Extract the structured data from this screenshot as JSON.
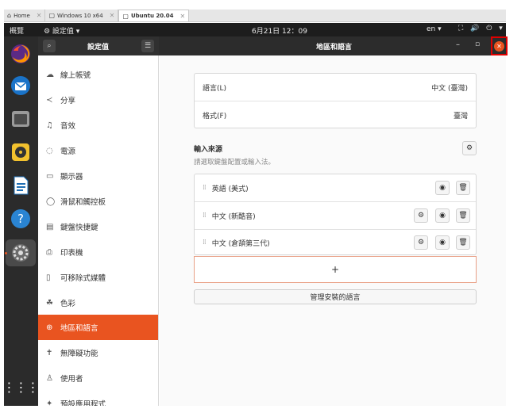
{
  "vm_tabs": [
    {
      "icon": "⌂",
      "label": "Home",
      "active": false
    },
    {
      "icon": "▢",
      "label": "Windows 10 x64",
      "active": false
    },
    {
      "icon": "▢",
      "label": "Ubuntu 20.04",
      "active": true
    }
  ],
  "topbar": {
    "activities": "概覽",
    "app_menu": "⚙ 設定值 ▾",
    "clock": "6月21日  12：09",
    "lang": "en ▾",
    "sys_icons": "⛶ 🔊 ⏻ ▾"
  },
  "dock": {
    "items": [
      "firefox-icon",
      "thunderbird-icon",
      "files-icon",
      "rhythmbox-icon",
      "writer-icon",
      "help-icon",
      "settings-icon"
    ],
    "apps_grid": "⋮⋮⋮"
  },
  "header": {
    "search_icon": "⌕",
    "sidebar_title": "設定值",
    "menu_icon": "☰",
    "main_title": "地區和語言",
    "minimize": "–",
    "maximize": "▫",
    "close": "✕"
  },
  "sidebar": {
    "items": [
      {
        "icon": "☁",
        "label": "線上帳號"
      },
      {
        "icon": "≺",
        "label": "分享"
      },
      {
        "icon": "♫",
        "label": "音效"
      },
      {
        "icon": "◌",
        "label": "電源"
      },
      {
        "icon": "▭",
        "label": "顯示器"
      },
      {
        "icon": "◯",
        "label": "滑鼠和觸控板"
      },
      {
        "icon": "▤",
        "label": "鍵盤快捷鍵"
      },
      {
        "icon": "⎙",
        "label": "印表機"
      },
      {
        "icon": "▯",
        "label": "可移除式媒體"
      },
      {
        "icon": "☘",
        "label": "色彩"
      },
      {
        "icon": "⊕",
        "label": "地區和語言"
      },
      {
        "icon": "✝",
        "label": "無障礙功能"
      },
      {
        "icon": "♙",
        "label": "使用者"
      },
      {
        "icon": "✦",
        "label": "預設應用程式"
      }
    ],
    "selected_index": 10
  },
  "main": {
    "language_label": "語言(L)",
    "language_value": "中文 (臺灣)",
    "formats_label": "格式(F)",
    "formats_value": "臺灣",
    "input_sources_title": "輸入來源",
    "input_sources_hint": "請選取鍵盤配置或輸入法。",
    "input_sources": [
      {
        "label": "英語 (美式)",
        "has_settings": false
      },
      {
        "label": "中文 (新酷音)",
        "has_settings": true
      },
      {
        "label": "中文 (倉頡第三代)",
        "has_settings": true
      }
    ],
    "add_label": "+",
    "manage_label": "管理安裝的語言"
  },
  "colors": {
    "accent": "#e95420",
    "topbar": "#1d1d1d",
    "highlight_box": "#e00000"
  }
}
